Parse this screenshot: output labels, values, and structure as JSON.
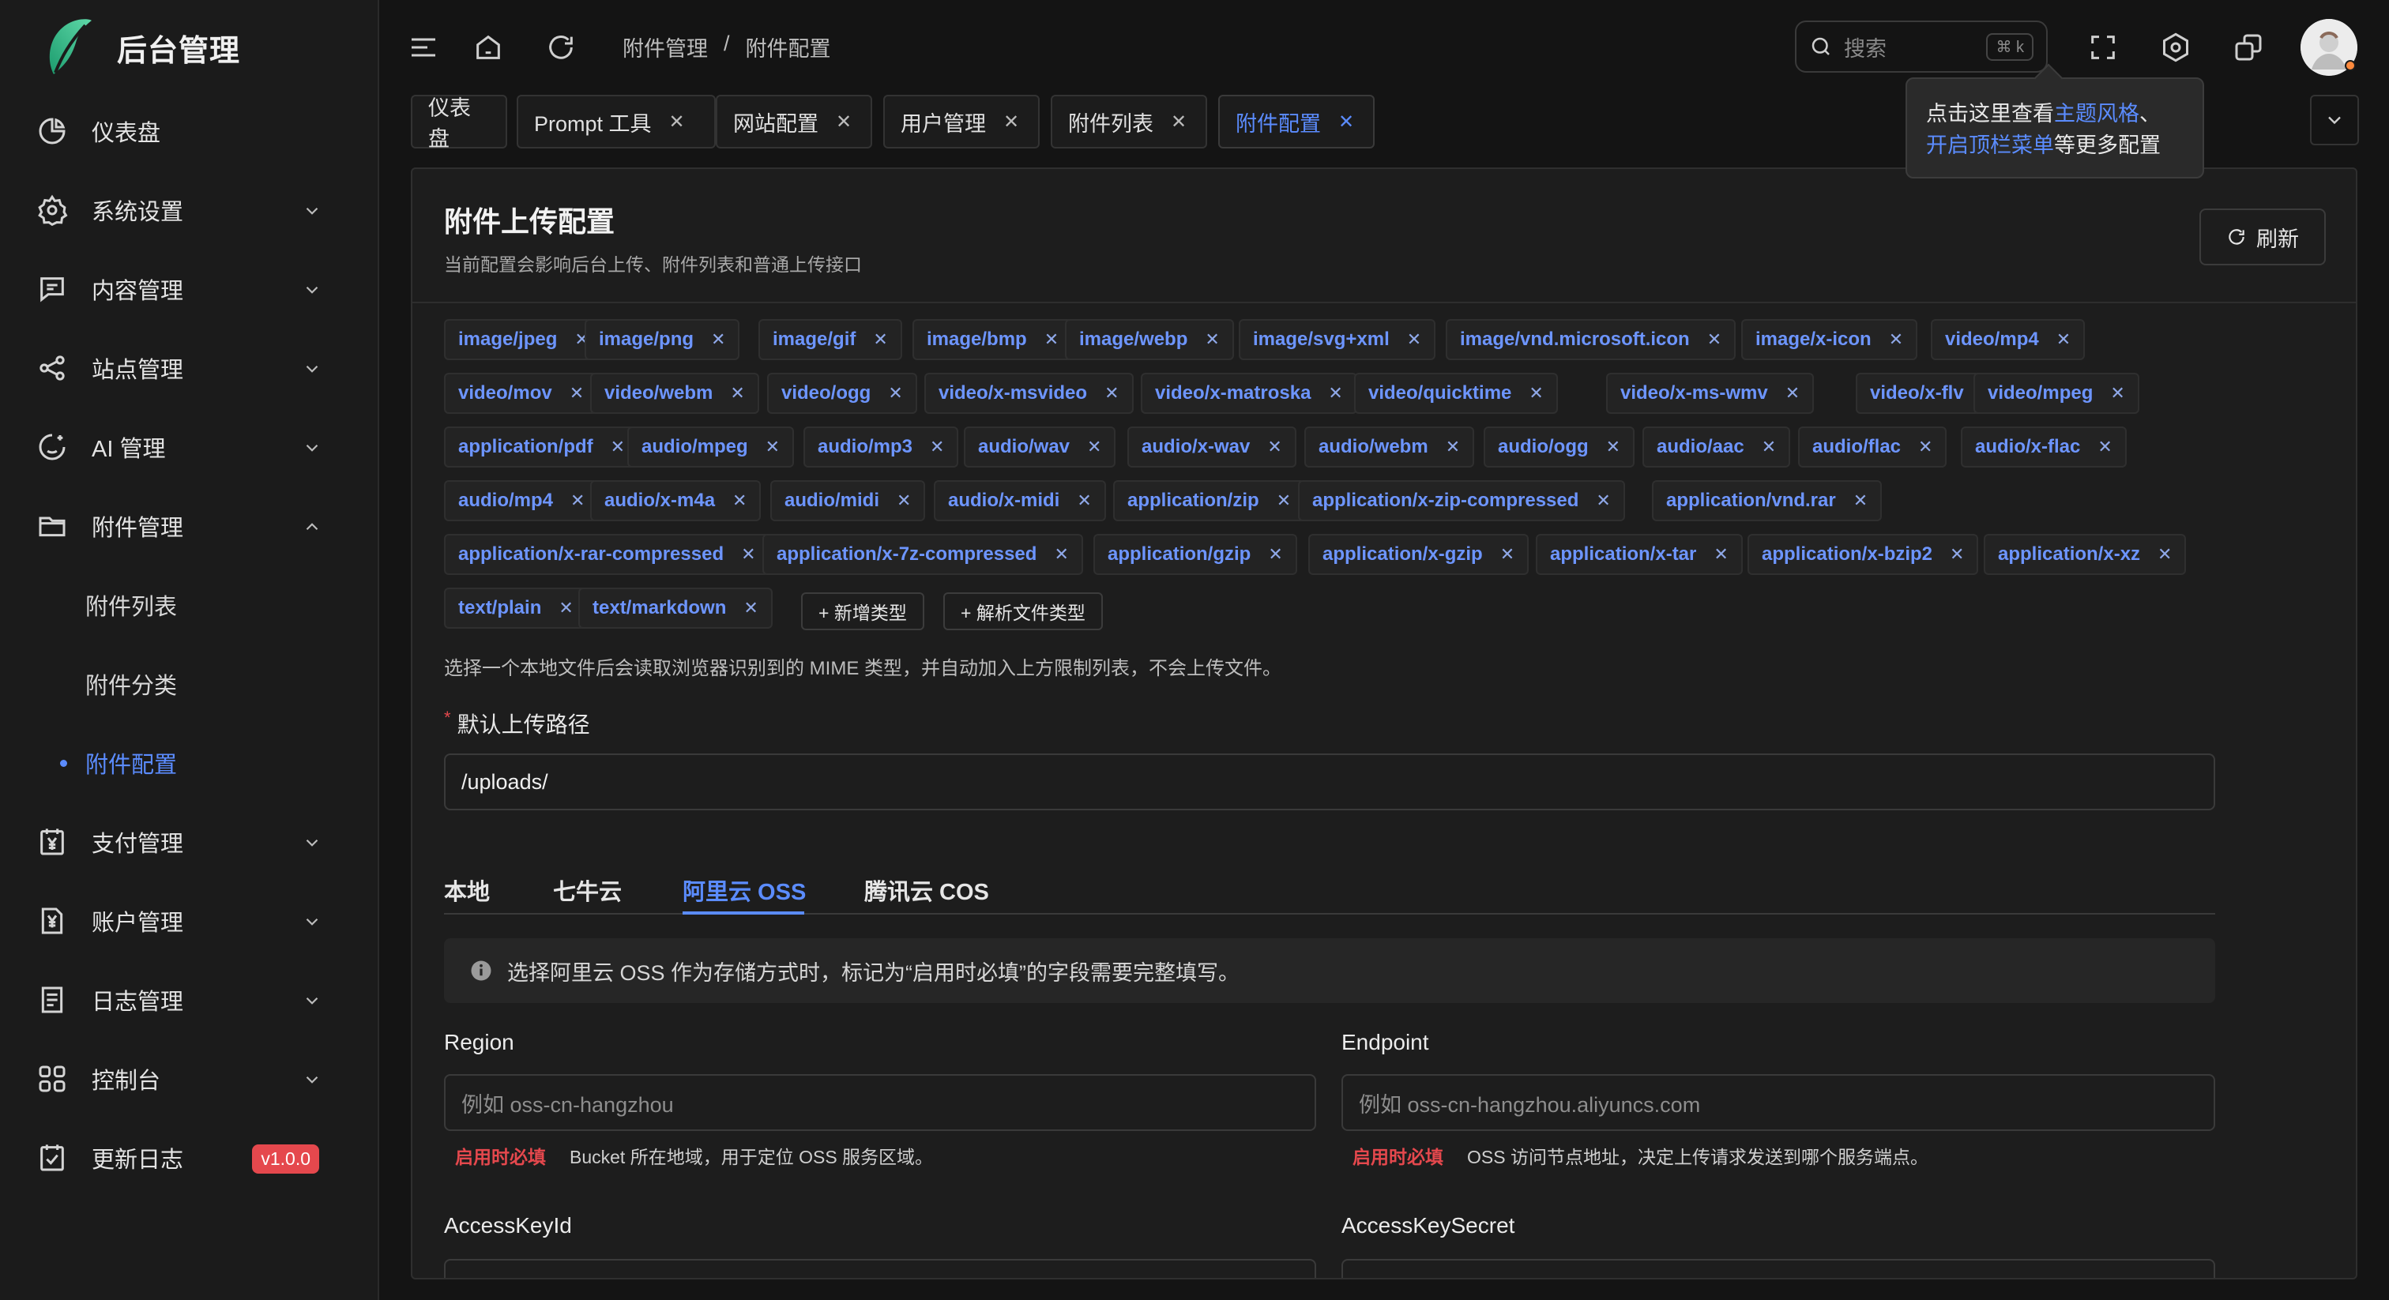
{
  "app": {
    "title": "后台管理"
  },
  "sidebar": {
    "items": [
      {
        "label": "仪表盘",
        "icon": "dashboard-icon"
      },
      {
        "label": "系统设置",
        "icon": "gear-icon"
      },
      {
        "label": "内容管理",
        "icon": "content-icon"
      },
      {
        "label": "站点管理",
        "icon": "share-icon"
      },
      {
        "label": "AI 管理",
        "icon": "ai-icon"
      },
      {
        "label": "附件管理",
        "icon": "folder-icon"
      },
      {
        "label": "支付管理",
        "icon": "yen-icon"
      },
      {
        "label": "账户管理",
        "icon": "account-icon"
      },
      {
        "label": "日志管理",
        "icon": "log-icon"
      },
      {
        "label": "控制台",
        "icon": "grid-icon"
      },
      {
        "label": "更新日志",
        "icon": "changelog-icon"
      }
    ],
    "sub_items": [
      {
        "label": "附件列表"
      },
      {
        "label": "附件分类"
      },
      {
        "label": "附件配置",
        "active": true
      }
    ],
    "version_badge": "v1.0.0"
  },
  "header": {
    "breadcrumb": [
      "附件管理",
      "/",
      "附件配置"
    ],
    "search": {
      "placeholder": "搜索",
      "shortcut": "⌘ k"
    }
  },
  "tabs": [
    {
      "label": "仪表盘",
      "closable": false
    },
    {
      "label": "Prompt 工具",
      "closable": true
    },
    {
      "label": "网站配置",
      "closable": true
    },
    {
      "label": "用户管理",
      "closable": true
    },
    {
      "label": "附件列表",
      "closable": true
    },
    {
      "label": "附件配置",
      "closable": true,
      "active": true
    }
  ],
  "tooltip": {
    "part1": "点击这里查看",
    "link1": "主题风格",
    "part2": "、",
    "link2": "开启顶栏菜单",
    "part3": "等更多配置"
  },
  "panel": {
    "title": "附件上传配置",
    "subtitle": "当前配置会影响后台上传、附件列表和普通上传接口",
    "refresh_label": "刷新"
  },
  "mime_types": [
    "image/jpeg",
    "image/png",
    "image/gif",
    "image/bmp",
    "image/webp",
    "image/svg+xml",
    "image/vnd.microsoft.icon",
    "image/x-icon",
    "video/mp4",
    "video/mov",
    "video/webm",
    "video/ogg",
    "video/x-msvideo",
    "video/x-matroska",
    "video/quicktime",
    "video/x-ms-wmv",
    "video/x-flv",
    "video/mpeg",
    "application/pdf",
    "audio/mpeg",
    "audio/mp3",
    "audio/wav",
    "audio/x-wav",
    "audio/webm",
    "audio/ogg",
    "audio/aac",
    "audio/flac",
    "audio/x-flac",
    "audio/mp4",
    "audio/x-m4a",
    "audio/midi",
    "audio/x-midi",
    "application/zip",
    "application/x-zip-compressed",
    "application/vnd.rar",
    "application/x-rar-compressed",
    "application/x-7z-compressed",
    "application/gzip",
    "application/x-gzip",
    "application/x-tar",
    "application/x-bzip2",
    "application/x-xz",
    "text/plain",
    "text/markdown"
  ],
  "mime_actions": {
    "add": "+ 新增类型",
    "parse": "+ 解析文件类型"
  },
  "mime_hint": "选择一个本地文件后会读取浏览器识别到的 MIME 类型，并自动加入上方限制列表，不会上传文件。",
  "upload_path": {
    "label": "默认上传路径",
    "value": "/uploads/"
  },
  "storage_tabs": [
    "本地",
    "七牛云",
    "阿里云 OSS",
    "腾讯云 COS"
  ],
  "storage_active": "阿里云 OSS",
  "alert": "选择阿里云 OSS 作为存储方式时，标记为“启用时必填”的字段需要完整填写。",
  "fields": {
    "region": {
      "label": "Region",
      "placeholder": "例如 oss-cn-hangzhou",
      "required_tag": "启用时必填",
      "help": "Bucket 所在地域，用于定位 OSS 服务区域。"
    },
    "endpoint": {
      "label": "Endpoint",
      "placeholder": "例如 oss-cn-hangzhou.aliyuncs.com",
      "required_tag": "启用时必填",
      "help": "OSS 访问节点地址，决定上传请求发送到哪个服务端点。"
    },
    "access_key_id": {
      "label": "AccessKeyId"
    },
    "access_key_secret": {
      "label": "AccessKeySecret"
    }
  },
  "colors": {
    "accent": "#5b8cff",
    "danger": "#e5484d",
    "background": "#141414",
    "sidebar": "#1b1b1b"
  }
}
